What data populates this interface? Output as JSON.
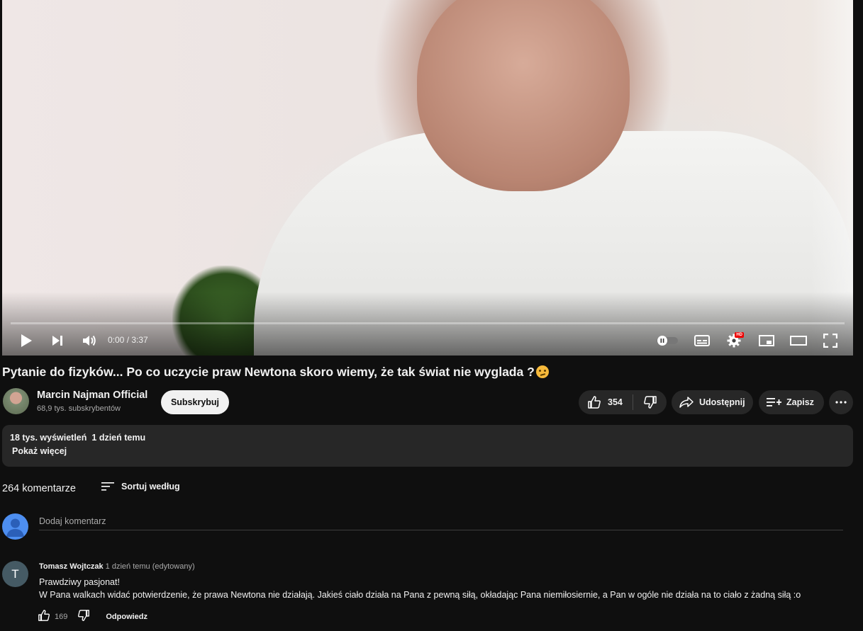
{
  "player": {
    "time": "0:00 / 3:37",
    "progress_fraction": 0
  },
  "video": {
    "title": "Pytanie do fizyków... Po co uczycie praw Newtona skoro wiemy, że tak świat nie wyglada ?",
    "title_emoji": "thinking-face-emoji"
  },
  "channel": {
    "name": "Marcin Najman Official",
    "subscribers": "68,9 tys. subskrybentów",
    "subscribe_label": "Subskrybuj"
  },
  "actions": {
    "likes": "354",
    "share_label": "Udostępnij",
    "save_label": "Zapisz"
  },
  "description": {
    "views": "18 tys. wyświetleń",
    "date": "1 dzień temu",
    "show_more": "Pokaż więcej"
  },
  "comments_header": {
    "count": "264 komentarze",
    "sort_label": "Sortuj według",
    "add_placeholder": "Dodaj komentarz"
  },
  "comments": [
    {
      "avatar_letter": "T",
      "author": "Tomasz Wojtczak",
      "time": "1 dzień temu (edytowany)",
      "lines": [
        "Prawdziwy pasjonat!",
        "W Pana walkach widać potwierdzenie, że prawa Newtona nie działają. Jakieś ciało działa na Pana z pewną siłą, okładając Pana niemiłosiernie, a Pan w ogóle nie działa na to ciało z żadną siłą :o"
      ],
      "likes": "169",
      "reply_label": "Odpowiedz"
    }
  ],
  "colors": {
    "background": "#0f0f0f",
    "surface": "#272727",
    "progress": "#ff0000",
    "avatar_blue": "#4d8ef0"
  }
}
